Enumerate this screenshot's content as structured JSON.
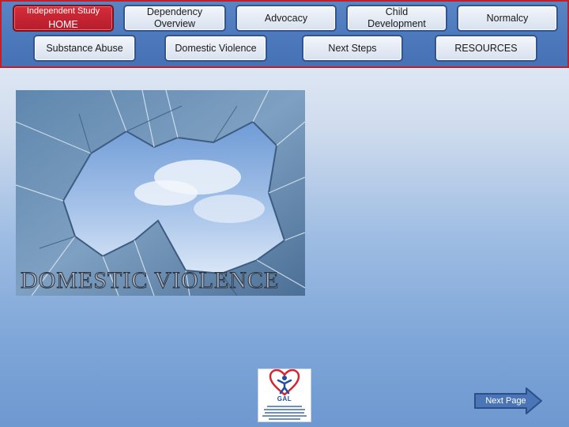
{
  "nav": {
    "home_line1": "Independent Study",
    "home_line2": "HOME",
    "dependency_line1": "Dependency",
    "dependency_line2": "Overview",
    "advocacy": "Advocacy",
    "child_line1": "Child",
    "child_line2": "Development",
    "normalcy": "Normalcy",
    "substance_abuse": "Substance Abuse",
    "domestic_violence": "Domestic Violence",
    "next_steps": "Next Steps",
    "resources": "RESOURCES"
  },
  "hero": {
    "title": "DOMESTIC VIOLENCE"
  },
  "logo": {
    "text": "GAL"
  },
  "footer": {
    "next_page": "Next Page"
  },
  "colors": {
    "nav_border": "#c0202a",
    "nav_background": "#4d7abd",
    "home_button": "#c62433",
    "logo_heart": "#d8242e",
    "logo_blue": "#1f4fa0"
  }
}
